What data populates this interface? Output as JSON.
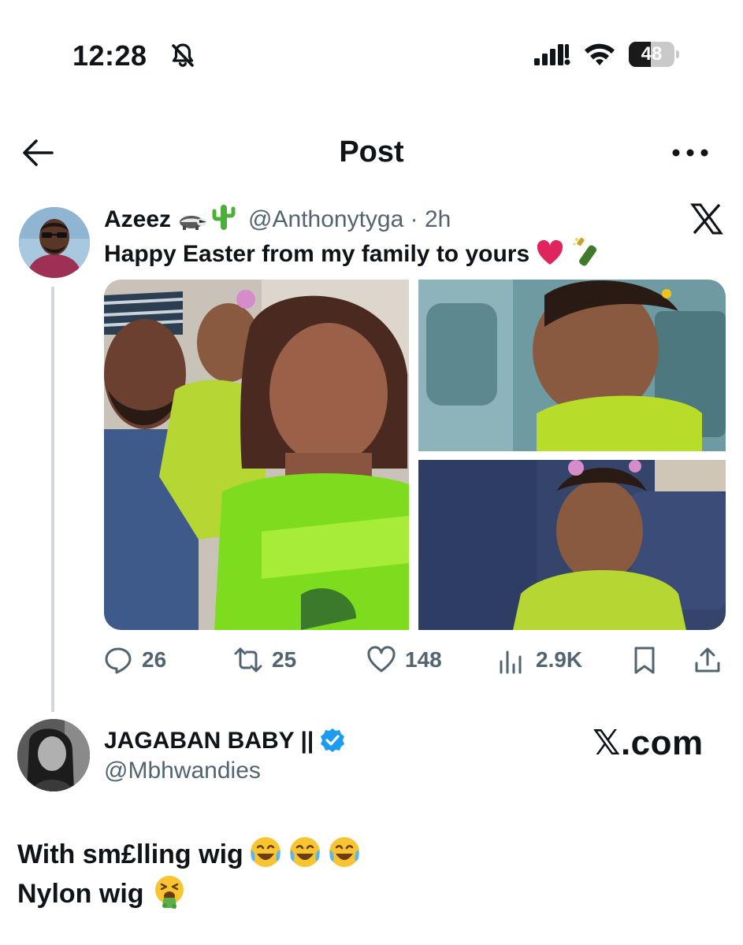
{
  "status_bar": {
    "time": "12:28",
    "battery": "48",
    "battery_level_percent": 48,
    "icons": [
      "bell-slash-icon",
      "cellular-signal-icon",
      "wifi-icon",
      "battery-icon"
    ]
  },
  "header": {
    "title": "Post",
    "back_icon": "arrow-left-icon",
    "more_icon": "more-dots-icon"
  },
  "post": {
    "display_name": "Azeez",
    "name_emojis": [
      "badger-emoji",
      "cactus-emoji"
    ],
    "handle": "@Anthonytyga",
    "time": "2h",
    "separator": " · ",
    "text": "Happy Easter from my family to yours",
    "text_emojis": [
      "red-heart-emoji",
      "champagne-bottle-emoji"
    ],
    "platform_icon": "x-logo-icon",
    "media_count": 3,
    "stats": {
      "replies": "26",
      "reposts": "25",
      "likes": "148",
      "views": "2.9K"
    },
    "action_icons": [
      "reply-icon",
      "repost-icon",
      "like-icon",
      "views-icon",
      "bookmark-icon",
      "share-icon"
    ]
  },
  "commenter": {
    "display_name": "JAGABAN BABY ||",
    "verified": true,
    "handle": "@Mbhwandies"
  },
  "watermark": {
    "x_char": "𝕏",
    "suffix": ".com"
  },
  "comment": {
    "line1": "With sm£lling wig",
    "line1_emojis": [
      "face-with-tears-of-joy-emoji",
      "face-with-tears-of-joy-emoji",
      "face-with-tears-of-joy-emoji"
    ],
    "line2": "Nylon wig",
    "line2_emojis": [
      "vomiting-face-emoji"
    ]
  },
  "colors": {
    "text": "#0f1419",
    "secondary": "#536471",
    "thread_line": "#cfd9de",
    "verified": "#1d9bf0",
    "heart": "#e0245e"
  }
}
